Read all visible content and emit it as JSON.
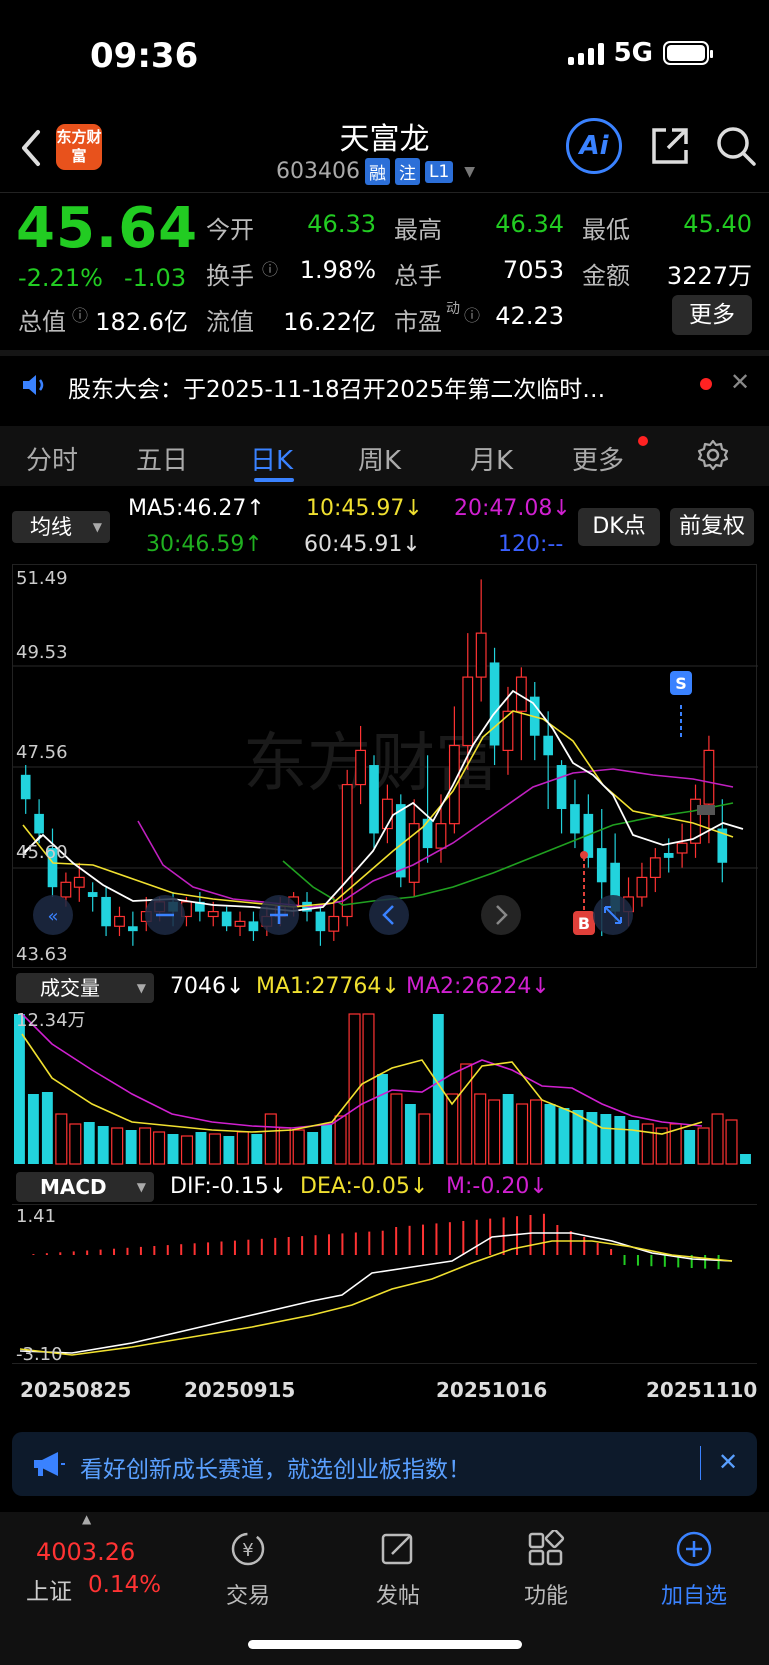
{
  "status": {
    "time": "09:36",
    "network": "5G"
  },
  "header": {
    "logo_text": "东方财富",
    "stock_name": "天富龙",
    "stock_code": "603406",
    "tags": [
      "融",
      "注",
      "L1"
    ],
    "ai_label": "Ai"
  },
  "quote": {
    "price": "45.64",
    "change_pct": "-2.21%",
    "change": "-1.03",
    "open_label": "今开",
    "open": "46.33",
    "high_label": "最高",
    "high": "46.34",
    "low_label": "最低",
    "low": "45.40",
    "turnover_label": "换手",
    "turnover": "1.98%",
    "volume_label": "总手",
    "volume": "7053",
    "amount_label": "金额",
    "amount": "3227万",
    "mcap_label": "总值",
    "mcap": "182.6亿",
    "float_label": "流值",
    "float": "16.22亿",
    "pe_label": "市盈",
    "pe_sup": "动",
    "pe": "42.23",
    "more_label": "更多"
  },
  "notice": {
    "text": "股东大会：于2025-11-18召开2025年第二次临时…"
  },
  "tabs": [
    "分时",
    "五日",
    "日K",
    "周K",
    "月K",
    "更多"
  ],
  "active_tab": "日K",
  "ma": {
    "selector": "均线",
    "ma5": "MA5:46.27↑",
    "ma10": "10:45.97↓",
    "ma20": "20:47.08↓",
    "ma30": "30:46.59↑",
    "ma60": "60:45.91↓",
    "ma120": "120:--",
    "dk_label": "DK点",
    "fq_label": "前复权"
  },
  "kline": {
    "y_labels": [
      "51.49",
      "49.53",
      "47.56",
      "45.60",
      "43.63"
    ],
    "markers": {
      "buy": "B",
      "sell": "S"
    }
  },
  "volume": {
    "selector": "成交量",
    "value": "7046↓",
    "ma1": "MA1:27764↓",
    "ma2": "MA2:26224↓",
    "max_label": "12.34万"
  },
  "macd": {
    "selector": "MACD",
    "dif": "DIF:-0.15↓",
    "dea": "DEA:-0.05↓",
    "m": "M:-0.20↓",
    "top_label": "1.41",
    "bottom_label": "-3.10"
  },
  "dates": [
    "20250825",
    "20250915",
    "20251016",
    "20251110"
  ],
  "ad": {
    "text": "看好创新成长赛道，就选创业板指数！"
  },
  "bottom_nav": {
    "index_value": "4003.26",
    "index_name": "上证",
    "index_change": "0.14%",
    "items": [
      "交易",
      "发帖",
      "功能",
      "加自选"
    ]
  },
  "colors": {
    "up": "#ff3333",
    "down": "#22cc22",
    "accent": "#3a82ff",
    "candle_down": "#22d3dd"
  },
  "chart_data": {
    "type": "candlestick",
    "ylim": [
      43.63,
      51.49
    ],
    "candles": [
      {
        "o": 47.4,
        "c": 46.9,
        "h": 47.6,
        "l": 46.6
      },
      {
        "o": 46.6,
        "c": 46.2,
        "h": 46.9,
        "l": 46.0
      },
      {
        "o": 45.9,
        "c": 45.1,
        "h": 46.3,
        "l": 44.9
      },
      {
        "o": 44.9,
        "c": 45.2,
        "h": 45.4,
        "l": 44.7
      },
      {
        "o": 45.1,
        "c": 45.3,
        "h": 45.6,
        "l": 44.8
      },
      {
        "o": 45.0,
        "c": 44.9,
        "h": 45.2,
        "l": 44.6
      },
      {
        "o": 44.9,
        "c": 44.3,
        "h": 45.1,
        "l": 44.1
      },
      {
        "o": 44.3,
        "c": 44.5,
        "h": 44.7,
        "l": 44.1
      },
      {
        "o": 44.3,
        "c": 44.2,
        "h": 44.6,
        "l": 43.9
      },
      {
        "o": 44.4,
        "c": 44.6,
        "h": 44.9,
        "l": 44.2
      },
      {
        "o": 44.6,
        "c": 44.8,
        "h": 44.9,
        "l": 44.4
      },
      {
        "o": 44.8,
        "c": 44.6,
        "h": 45.0,
        "l": 44.3
      },
      {
        "o": 44.5,
        "c": 44.8,
        "h": 44.9,
        "l": 44.3
      },
      {
        "o": 44.8,
        "c": 44.6,
        "h": 45.0,
        "l": 44.4
      },
      {
        "o": 44.5,
        "c": 44.6,
        "h": 44.8,
        "l": 44.3
      },
      {
        "o": 44.6,
        "c": 44.3,
        "h": 44.7,
        "l": 44.2
      },
      {
        "o": 44.3,
        "c": 44.4,
        "h": 44.6,
        "l": 44.1
      },
      {
        "o": 44.4,
        "c": 44.2,
        "h": 44.6,
        "l": 44.0
      },
      {
        "o": 44.3,
        "c": 44.5,
        "h": 44.7,
        "l": 44.1
      },
      {
        "o": 44.5,
        "c": 44.7,
        "h": 44.9,
        "l": 44.3
      },
      {
        "o": 44.7,
        "c": 44.9,
        "h": 45.0,
        "l": 44.5
      },
      {
        "o": 44.8,
        "c": 44.6,
        "h": 45.0,
        "l": 44.4
      },
      {
        "o": 44.6,
        "c": 44.2,
        "h": 44.7,
        "l": 43.9
      },
      {
        "o": 44.2,
        "c": 44.5,
        "h": 44.9,
        "l": 44.0
      },
      {
        "o": 44.5,
        "c": 47.2,
        "h": 47.5,
        "l": 44.3
      },
      {
        "o": 47.2,
        "c": 47.9,
        "h": 48.4,
        "l": 46.8
      },
      {
        "o": 47.6,
        "c": 46.2,
        "h": 47.8,
        "l": 45.9
      },
      {
        "o": 46.3,
        "c": 46.9,
        "h": 47.2,
        "l": 46.0
      },
      {
        "o": 46.8,
        "c": 45.3,
        "h": 47.0,
        "l": 45.1
      },
      {
        "o": 45.2,
        "c": 46.4,
        "h": 46.9,
        "l": 44.9
      },
      {
        "o": 46.5,
        "c": 45.9,
        "h": 47.8,
        "l": 45.6
      },
      {
        "o": 45.9,
        "c": 46.4,
        "h": 47.0,
        "l": 45.6
      },
      {
        "o": 46.4,
        "c": 48.0,
        "h": 48.8,
        "l": 46.2
      },
      {
        "o": 48.0,
        "c": 49.4,
        "h": 50.3,
        "l": 47.5
      },
      {
        "o": 49.4,
        "c": 50.3,
        "h": 51.4,
        "l": 48.9
      },
      {
        "o": 49.7,
        "c": 48.0,
        "h": 50.0,
        "l": 47.6
      },
      {
        "o": 47.9,
        "c": 48.7,
        "h": 49.2,
        "l": 47.4
      },
      {
        "o": 48.7,
        "c": 49.4,
        "h": 49.6,
        "l": 47.7
      },
      {
        "o": 49.0,
        "c": 48.2,
        "h": 49.3,
        "l": 47.7
      },
      {
        "o": 48.2,
        "c": 47.8,
        "h": 48.7,
        "l": 46.7
      },
      {
        "o": 47.6,
        "c": 46.7,
        "h": 47.7,
        "l": 46.2
      },
      {
        "o": 46.8,
        "c": 46.2,
        "h": 47.3,
        "l": 45.9
      },
      {
        "o": 46.6,
        "c": 45.7,
        "h": 47.0,
        "l": 45.5
      },
      {
        "o": 45.9,
        "c": 45.2,
        "h": 46.7,
        "l": 44.1
      },
      {
        "o": 45.6,
        "c": 44.6,
        "h": 46.2,
        "l": 44.4
      },
      {
        "o": 44.6,
        "c": 44.9,
        "h": 45.3,
        "l": 44.3
      },
      {
        "o": 44.9,
        "c": 45.3,
        "h": 45.6,
        "l": 44.7
      },
      {
        "o": 45.3,
        "c": 45.7,
        "h": 45.9,
        "l": 45.0
      },
      {
        "o": 45.8,
        "c": 45.7,
        "h": 46.1,
        "l": 45.4
      },
      {
        "o": 45.8,
        "c": 46.0,
        "h": 46.4,
        "l": 45.5
      },
      {
        "o": 46.0,
        "c": 46.9,
        "h": 47.2,
        "l": 45.7
      },
      {
        "o": 46.8,
        "c": 47.9,
        "h": 48.2,
        "l": 46.0
      },
      {
        "o": 46.3,
        "c": 45.6,
        "h": 46.9,
        "l": 45.2
      }
    ]
  }
}
